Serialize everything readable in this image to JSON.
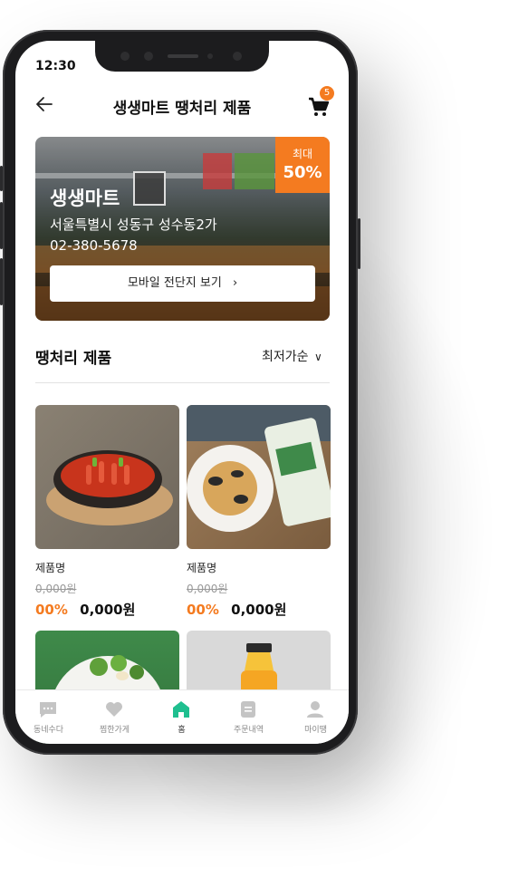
{
  "status_bar": {
    "time": "12:30"
  },
  "header": {
    "title": "생생마트 땡처리 제품",
    "cart_count": "5"
  },
  "banner": {
    "discount_line1": "최대",
    "discount_line2": "50%",
    "store_name": "생생마트",
    "address": "서울특별시 성동구 성수동2가",
    "phone": "02-380-5678",
    "flyer_button": "모바일 전단지 보기"
  },
  "section": {
    "title": "땡처리 제품",
    "sort_label": "최저가순"
  },
  "products": [
    {
      "name": "제품명",
      "original_price": "0,000원",
      "discount": "00%",
      "price": "0,000원"
    },
    {
      "name": "제품명",
      "original_price": "0,000원",
      "discount": "00%",
      "price": "0,000원"
    }
  ],
  "bottom_nav": [
    {
      "label": "동네수다",
      "icon": "chat-icon"
    },
    {
      "label": "찜한가게",
      "icon": "heart-icon"
    },
    {
      "label": "홈",
      "icon": "home-icon"
    },
    {
      "label": "주문내역",
      "icon": "receipt-icon"
    },
    {
      "label": "마이땡",
      "icon": "person-icon"
    }
  ],
  "colors": {
    "accent": "#f47b20",
    "active_nav": "#1fbf8f",
    "inactive_nav": "#c4c4c4"
  }
}
